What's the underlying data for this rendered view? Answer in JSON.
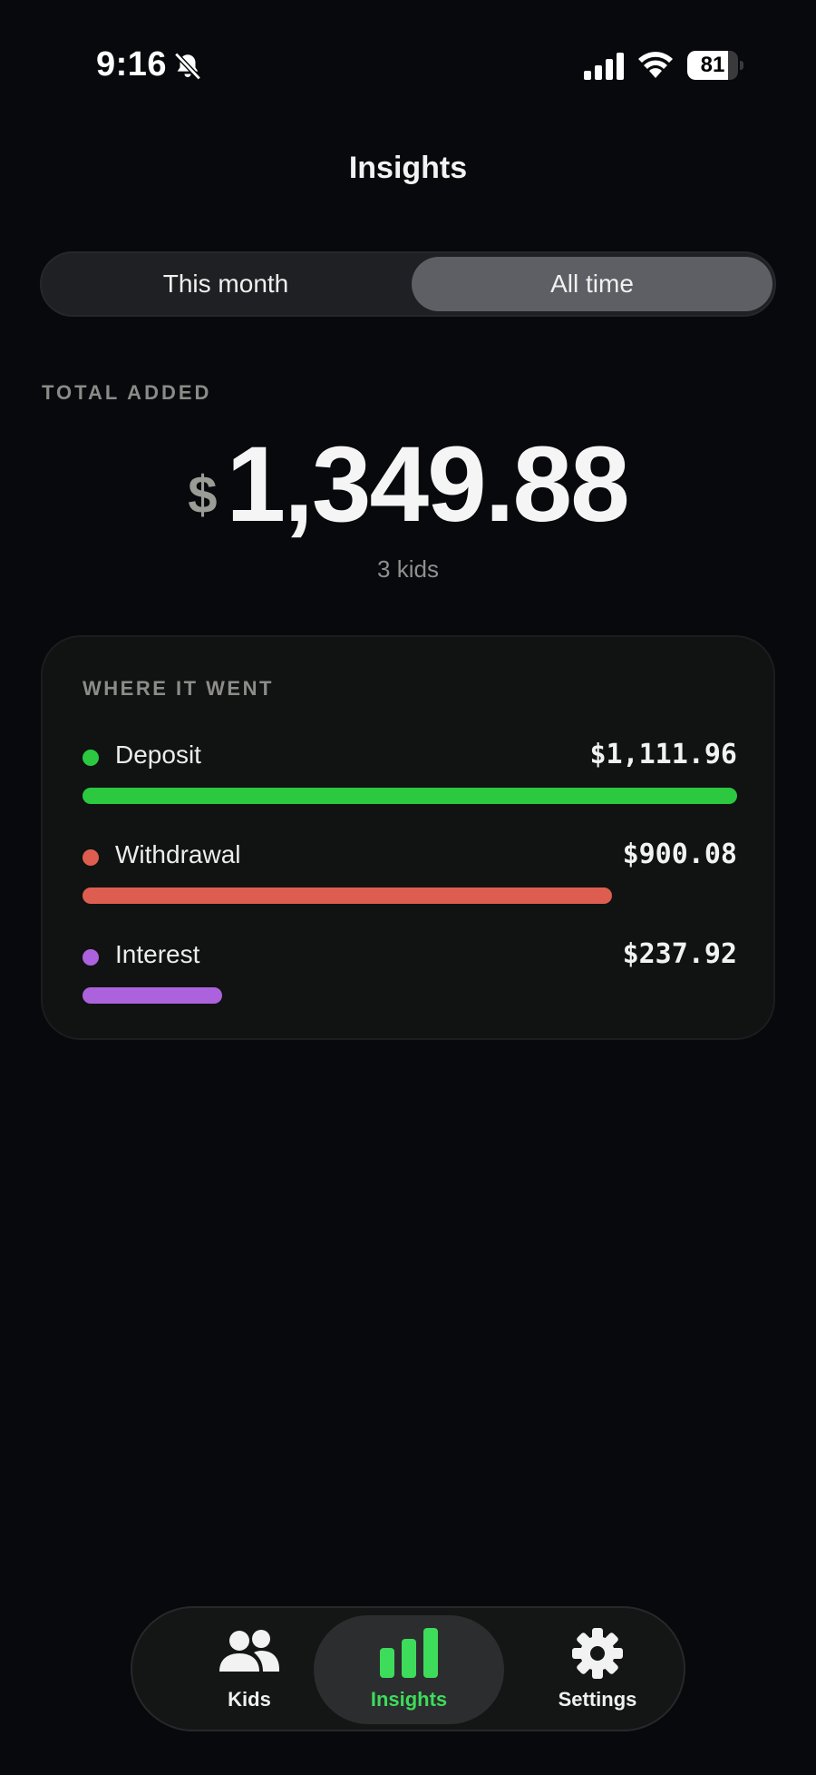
{
  "status_bar": {
    "time": "9:16",
    "battery_level": "81",
    "battery_fraction": 0.81,
    "icons": [
      "bell-slash-icon",
      "cellular-signal-icon",
      "wifi-icon",
      "battery-icon"
    ]
  },
  "header": {
    "title": "Insights"
  },
  "period_toggle": {
    "options": [
      "This month",
      "All time"
    ],
    "selected": "All time"
  },
  "summary": {
    "label": "TOTAL ADDED",
    "currency_symbol": "$",
    "amount": "1,349.88",
    "subtitle": "3 kids"
  },
  "breakdown": {
    "title": "WHERE IT WENT",
    "items": [
      {
        "label": "Deposit",
        "value": "$1,111.96",
        "amount": 1111.96,
        "color": "#2bc840"
      },
      {
        "label": "Withdrawal",
        "value": "$900.08",
        "amount": 900.08,
        "color": "#dd5e50"
      },
      {
        "label": "Interest",
        "value": "$237.92",
        "amount": 237.92,
        "color": "#ac62dc"
      }
    ]
  },
  "tab_bar": {
    "items": [
      {
        "label": "Kids",
        "icon": "people-icon"
      },
      {
        "label": "Insights",
        "icon": "bar-chart-icon"
      },
      {
        "label": "Settings",
        "icon": "gear-icon"
      }
    ],
    "selected": "Insights",
    "accent_color": "#3ddc5a"
  }
}
